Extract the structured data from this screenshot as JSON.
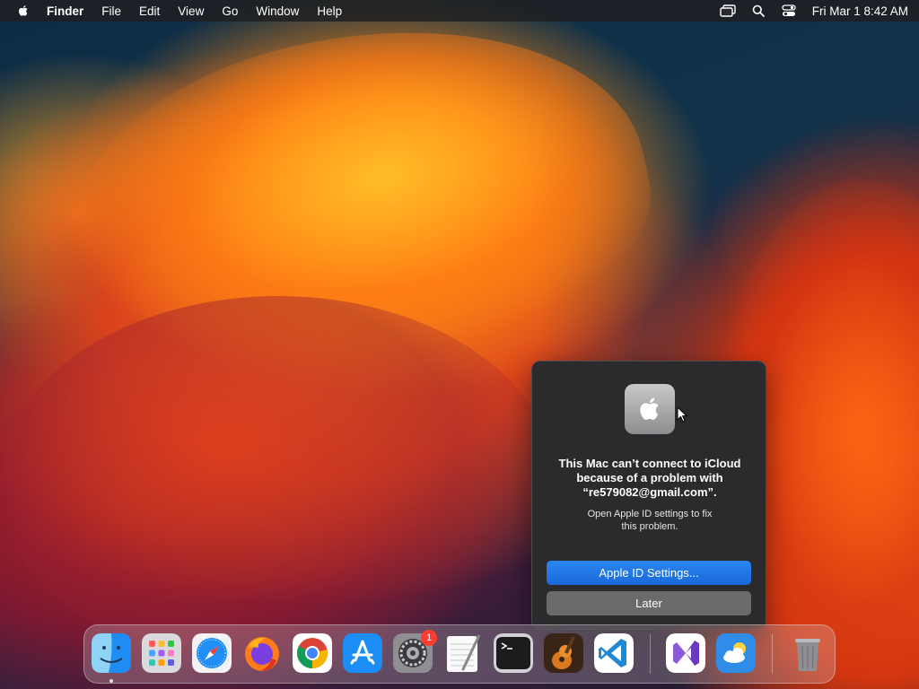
{
  "menubar": {
    "app_name": "Finder",
    "items": [
      "File",
      "Edit",
      "View",
      "Go",
      "Window",
      "Help"
    ],
    "status_icons": [
      "screen-mirroring-icon",
      "spotlight-search-icon",
      "control-center-icon"
    ],
    "clock": "Fri Mar 1  8:42 AM"
  },
  "dialog": {
    "icon": "apple-logo-icon",
    "title_line1": "This Mac can’t connect to iCloud",
    "title_line2": "because of a problem with",
    "title_line3": "“re579082@gmail.com”.",
    "message_line1": "Open Apple ID settings to fix",
    "message_line2": "this problem.",
    "primary_button": "Apple ID Settings...",
    "secondary_button": "Later",
    "accent_color": "#1f72e6"
  },
  "dock": {
    "apps": [
      {
        "name": "Finder",
        "icon": "finder-icon",
        "running": true
      },
      {
        "name": "Launchpad",
        "icon": "launchpad-icon",
        "running": false
      },
      {
        "name": "Safari",
        "icon": "safari-icon",
        "running": false
      },
      {
        "name": "Firefox",
        "icon": "firefox-icon",
        "running": false
      },
      {
        "name": "Google Chrome",
        "icon": "chrome-icon",
        "running": false
      },
      {
        "name": "App Store",
        "icon": "app-store-icon",
        "running": false
      },
      {
        "name": "System Settings",
        "icon": "system-settings-icon",
        "running": false,
        "badge": "1"
      },
      {
        "name": "TextEdit",
        "icon": "textedit-icon",
        "running": false
      },
      {
        "name": "Terminal",
        "icon": "terminal-icon",
        "running": false
      },
      {
        "name": "GarageBand",
        "icon": "garageband-icon",
        "running": false
      },
      {
        "name": "Visual Studio Code",
        "icon": "vscode-icon",
        "running": false
      },
      {
        "name": "Visual Studio",
        "icon": "visual-studio-icon",
        "running": false
      },
      {
        "name": "Weather",
        "icon": "weather-icon",
        "running": false
      },
      {
        "name": "Trash",
        "icon": "trash-icon",
        "running": false
      }
    ],
    "settings_badge": "1"
  }
}
